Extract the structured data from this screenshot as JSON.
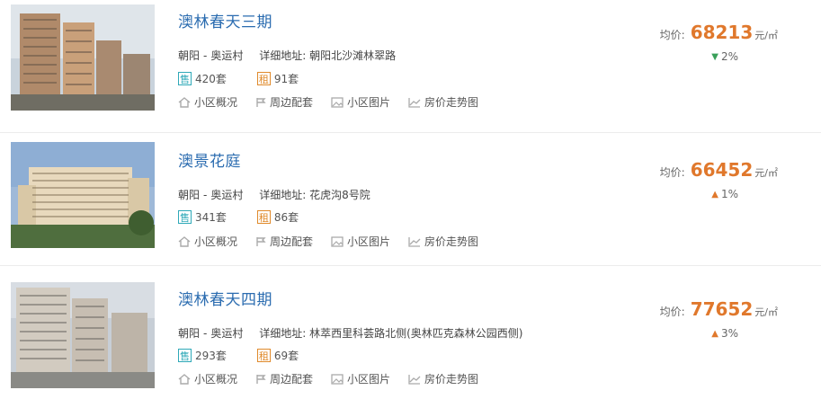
{
  "listings": [
    {
      "name": "澳林春天三期",
      "district": "朝阳",
      "area": "奥运村",
      "address_label": "详细地址:",
      "address": "朝阳北沙滩林翠路",
      "sale_badge": "售",
      "sale_count": "420套",
      "rent_badge": "租",
      "rent_count": "91套",
      "links": [
        "小区概况",
        "周边配套",
        "小区图片",
        "房价走势图"
      ],
      "price_label": "均价:",
      "price": "68213",
      "price_unit": "元/㎡",
      "change": "2%",
      "change_direction": "down"
    },
    {
      "name": "澳景花庭",
      "district": "朝阳",
      "area": "奥运村",
      "address_label": "详细地址:",
      "address": "花虎沟8号院",
      "sale_badge": "售",
      "sale_count": "341套",
      "rent_badge": "租",
      "rent_count": "86套",
      "links": [
        "小区概况",
        "周边配套",
        "小区图片",
        "房价走势图"
      ],
      "price_label": "均价:",
      "price": "66452",
      "price_unit": "元/㎡",
      "change": "1%",
      "change_direction": "up"
    },
    {
      "name": "澳林春天四期",
      "district": "朝阳",
      "area": "奥运村",
      "address_label": "详细地址:",
      "address": "林萃西里科荟路北侧(奥林匹克森林公园西侧)",
      "sale_badge": "售",
      "sale_count": "293套",
      "rent_badge": "租",
      "rent_count": "69套",
      "links": [
        "小区概况",
        "周边配套",
        "小区图片",
        "房价走势图"
      ],
      "price_label": "均价:",
      "price": "77652",
      "price_unit": "元/㎡",
      "change": "3%",
      "change_direction": "up"
    }
  ]
}
